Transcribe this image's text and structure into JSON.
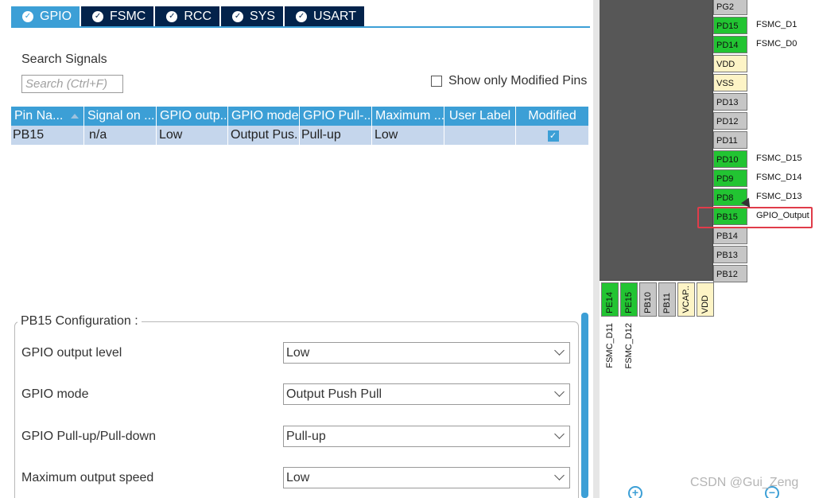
{
  "tabs": [
    {
      "label": "GPIO",
      "active": true
    },
    {
      "label": "FSMC",
      "active": false
    },
    {
      "label": "RCC",
      "active": false
    },
    {
      "label": "SYS",
      "active": false
    },
    {
      "label": "USART",
      "active": false
    }
  ],
  "search": {
    "label": "Search Signals",
    "placeholder": "Search (Ctrl+F)",
    "value": ""
  },
  "show_modified": {
    "label": "Show only Modified Pins",
    "checked": false
  },
  "table": {
    "columns": [
      "Pin Na...",
      "Signal on ...",
      "GPIO outp...",
      "GPIO mode",
      "GPIO Pull-...",
      "Maximum ...",
      "User Label",
      "Modified"
    ],
    "rows": [
      {
        "pin": "PB15",
        "signal": "n/a",
        "output_level": "Low",
        "mode": "Output Pus...",
        "pull": "Pull-up",
        "speed": "Low",
        "user_label": "",
        "modified": true
      }
    ]
  },
  "config": {
    "title": "PB15 Configuration :",
    "fields": [
      {
        "label": "GPIO output level",
        "value": "Low"
      },
      {
        "label": "GPIO mode",
        "value": "Output Push Pull"
      },
      {
        "label": "GPIO Pull-up/Pull-down",
        "value": "Pull-up"
      },
      {
        "label": "Maximum output speed",
        "value": "Low"
      }
    ]
  },
  "chip": {
    "right_pins": [
      {
        "name": "PG2",
        "color": "gray",
        "signal": ""
      },
      {
        "name": "PD15",
        "color": "green",
        "signal": "FSMC_D1"
      },
      {
        "name": "PD14",
        "color": "green",
        "signal": "FSMC_D0"
      },
      {
        "name": "VDD",
        "color": "yellow",
        "signal": ""
      },
      {
        "name": "VSS",
        "color": "yellow",
        "signal": ""
      },
      {
        "name": "PD13",
        "color": "gray",
        "signal": ""
      },
      {
        "name": "PD12",
        "color": "gray",
        "signal": ""
      },
      {
        "name": "PD11",
        "color": "gray",
        "signal": ""
      },
      {
        "name": "PD10",
        "color": "green",
        "signal": "FSMC_D15"
      },
      {
        "name": "PD9",
        "color": "green",
        "signal": "FSMC_D14"
      },
      {
        "name": "PD8",
        "color": "green",
        "signal": "FSMC_D13"
      },
      {
        "name": "PB15",
        "color": "green",
        "signal": "GPIO_Output"
      },
      {
        "name": "PB14",
        "color": "gray",
        "signal": ""
      },
      {
        "name": "PB13",
        "color": "gray",
        "signal": ""
      },
      {
        "name": "PB12",
        "color": "gray",
        "signal": ""
      }
    ],
    "bottom_pins": [
      {
        "name": "PE14",
        "color": "green",
        "signal": "FSMC_D11"
      },
      {
        "name": "PE15",
        "color": "green",
        "signal": "FSMC_D12"
      },
      {
        "name": "PB10",
        "color": "gray",
        "signal": ""
      },
      {
        "name": "PB11",
        "color": "gray",
        "signal": ""
      },
      {
        "name": "VCAP..",
        "color": "yellow",
        "signal": ""
      },
      {
        "name": "VDD",
        "color": "yellow",
        "signal": ""
      }
    ],
    "zoom_in": "+",
    "zoom_out": "−"
  },
  "watermark": "CSDN @Gui_Zeng",
  "colors": {
    "accent": "#3c9fd6",
    "tab_dark": "#03234b",
    "pin_green": "#22c432",
    "highlight": "#e03c4a"
  }
}
